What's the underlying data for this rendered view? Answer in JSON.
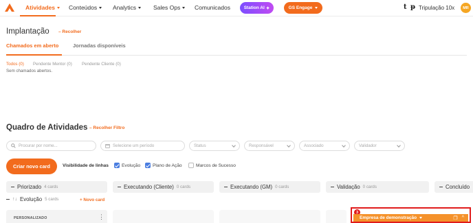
{
  "nav": {
    "items": [
      {
        "label": "Atividades"
      },
      {
        "label": "Conteúdos"
      },
      {
        "label": "Analytics"
      },
      {
        "label": "Sales Ops"
      },
      {
        "label": "Comunicados"
      }
    ],
    "station_ai": "Station AI",
    "gs_engage": "GS Engage",
    "team": "Tripulação 10x",
    "avatar_initials": "MR",
    "brand_color": "#f26b1d"
  },
  "page": {
    "title": "Implantação",
    "collapse_label": "Recolher",
    "tabs": [
      {
        "label": "Chamados em aberto"
      },
      {
        "label": "Jornadas disponíveis"
      }
    ],
    "filters": [
      {
        "label": "Todos (0)"
      },
      {
        "label": "Pendente Mentor (0)"
      },
      {
        "label": "Pendente Cliente (0)"
      }
    ],
    "empty_text": "Sem chamados abertos."
  },
  "board": {
    "title": "Quadro de Atividades",
    "collapse_filter_label": "Recolher Filtro",
    "search_placeholder": "Procurar por nome...",
    "period_placeholder": "Selecione um período",
    "status_placeholder": "Status",
    "responsible_placeholder": "Responsável",
    "associate_placeholder": "Associado",
    "validator_placeholder": "Validador",
    "new_card_label": "Criar novo card",
    "visibility_label": "Visibilidade de linhas",
    "checkboxes": [
      {
        "label": "Evolução",
        "checked": true
      },
      {
        "label": "Plano de Ação",
        "checked": true
      },
      {
        "label": "Marcos de Sucesso",
        "checked": false
      }
    ],
    "columns": [
      {
        "name": "Priorizado",
        "count": "4 cards"
      },
      {
        "name": "Executando (Cliente)",
        "count": "0 cards"
      },
      {
        "name": "Executando (GM)",
        "count": "0 cards"
      },
      {
        "name": "Validação",
        "count": "0 cards"
      },
      {
        "name": "Concluído",
        "count": ""
      }
    ],
    "row": {
      "name": "Evolução",
      "count": "5 cards",
      "add_label": "+ Novo card"
    },
    "card_label": "PERSONALIZADO"
  },
  "demo": {
    "badge": "3",
    "label": "Empresa de demonstração"
  }
}
